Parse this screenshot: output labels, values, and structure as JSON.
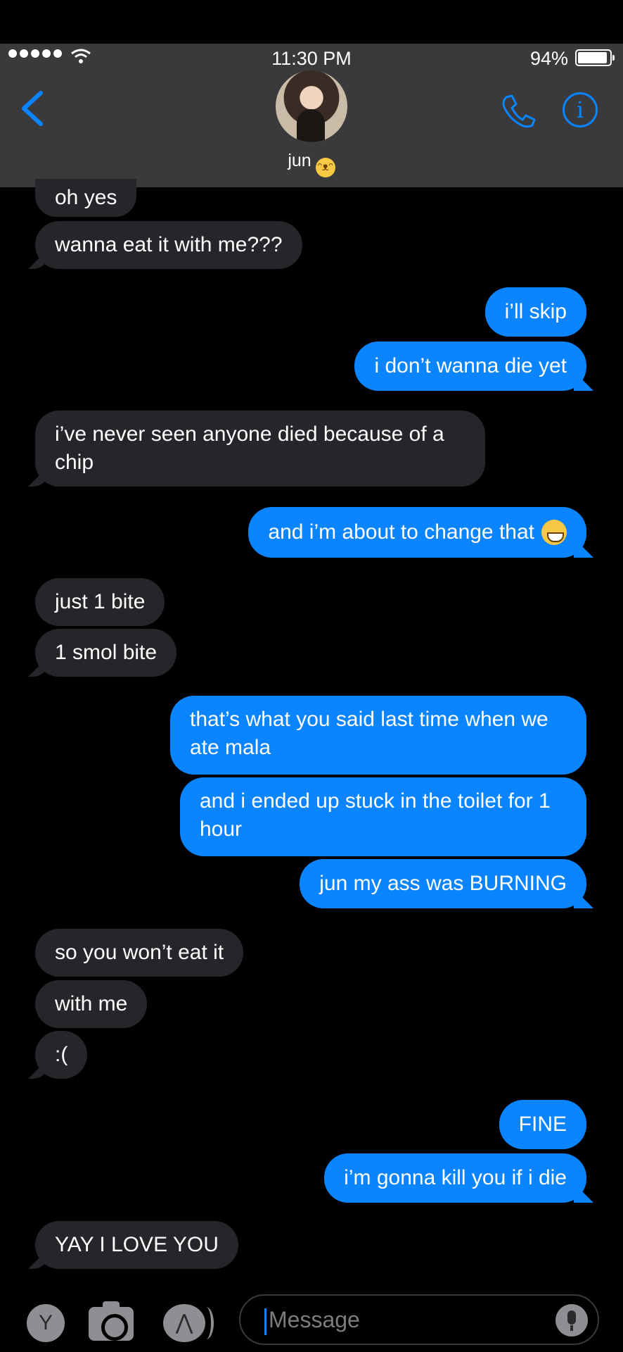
{
  "status_bar": {
    "time": "11:30 PM",
    "battery": "94%"
  },
  "header": {
    "contact_name": "jun",
    "name_emoji_icon": "smiling-cat-icon"
  },
  "messages": [
    {
      "side": "in",
      "text": "oh yes"
    },
    {
      "side": "in",
      "text": "wanna eat it with me???"
    },
    {
      "side": "out",
      "text": "i’ll skip"
    },
    {
      "side": "out",
      "text": "i don’t wanna die yet"
    },
    {
      "side": "in",
      "text": "i’ve never seen anyone died because of a chip"
    },
    {
      "side": "out",
      "text": "and i’m about to change that"
    },
    {
      "side": "in",
      "text": "just 1 bite"
    },
    {
      "side": "in",
      "text": "1 smol bite"
    },
    {
      "side": "out",
      "text": "that’s what you said last time when we ate mala"
    },
    {
      "side": "out",
      "text": "and i ended up stuck in the toilet for 1 hour"
    },
    {
      "side": "out",
      "text": "jun my ass was BURNING"
    },
    {
      "side": "in",
      "text": "so you won’t eat it"
    },
    {
      "side": "in",
      "text": "with me"
    },
    {
      "side": "in",
      "text": ":("
    },
    {
      "side": "out",
      "text": "FINE"
    },
    {
      "side": "out",
      "text": "i’m gonna kill you if i die"
    },
    {
      "side": "in",
      "text": "YAY I LOVE YOU"
    }
  ],
  "input_bar": {
    "app_button_label": "Y",
    "placeholder": "Message"
  },
  "colors": {
    "accent": "#0a84ff",
    "incoming_bubble": "#26252a",
    "header_bg": "#3a3a3c"
  }
}
